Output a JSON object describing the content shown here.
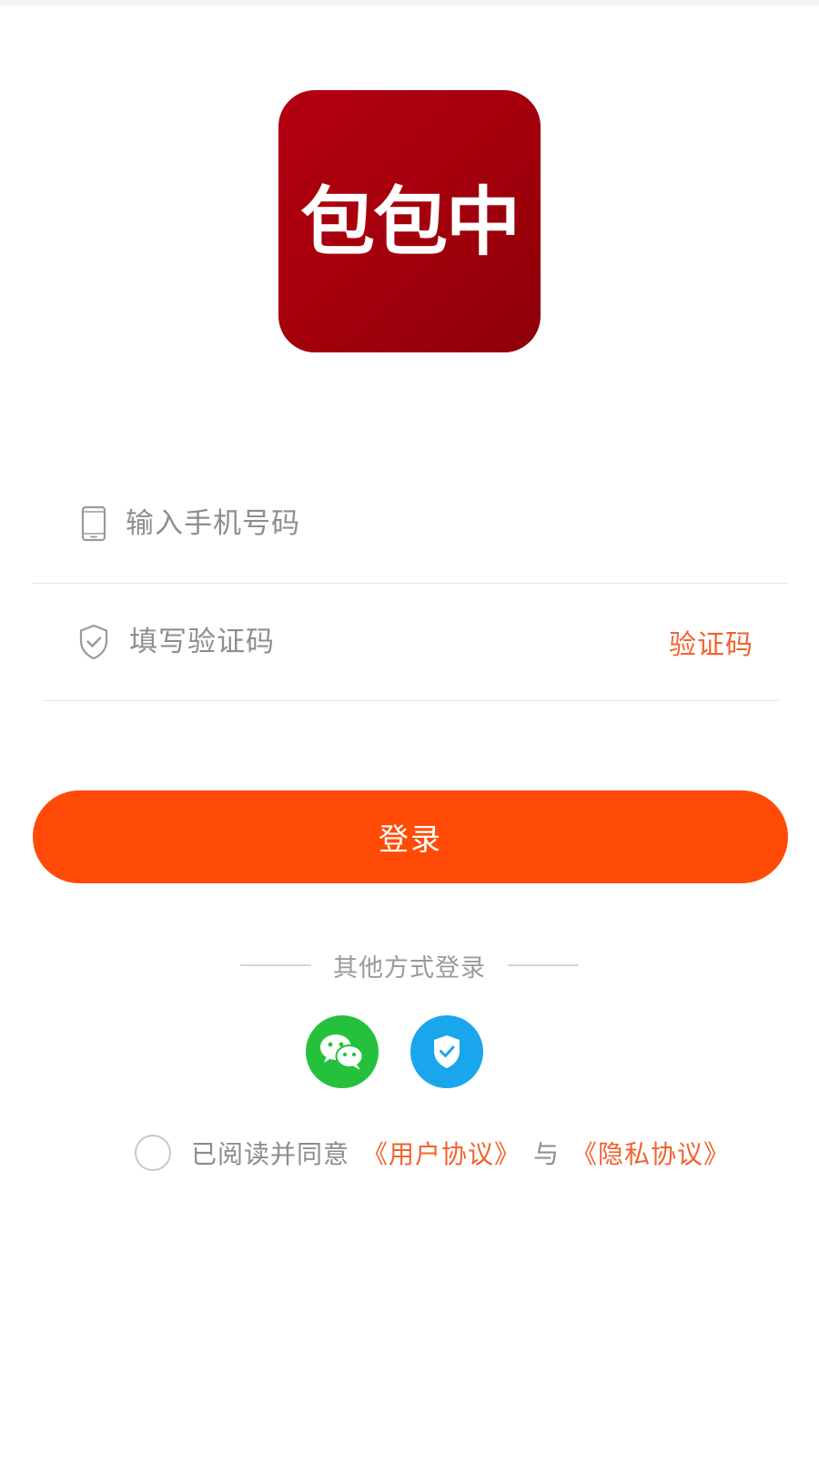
{
  "app": {
    "logo_text": "包包中",
    "logo_color": "#a6000c"
  },
  "login_form": {
    "phone": {
      "icon": "phone-icon",
      "placeholder": "输入手机号码",
      "value": ""
    },
    "code": {
      "icon": "shield-check-icon",
      "placeholder": "填写验证码",
      "value": "",
      "get_code_label": "验证码"
    },
    "submit_label": "登录"
  },
  "other_login": {
    "label": "其他方式登录",
    "methods": [
      {
        "icon": "wechat-icon",
        "color": "#25c13d"
      },
      {
        "icon": "shield-verify-icon",
        "color": "#1aa6ed"
      }
    ]
  },
  "agreement": {
    "checked": false,
    "prefix": "已阅读并同意",
    "user_agreement": "《用户协议》",
    "connector": "与",
    "privacy_policy": "《隐私协议》"
  },
  "colors": {
    "accent": "#ff4b07",
    "link": "#f2622f"
  }
}
